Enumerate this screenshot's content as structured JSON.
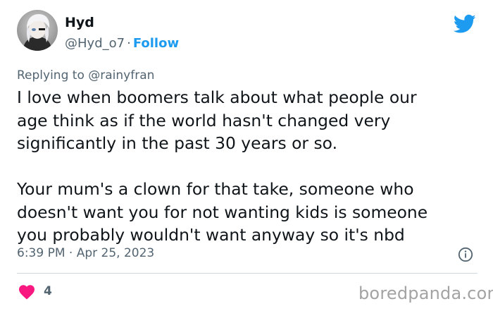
{
  "author": {
    "display_name": "Hyd",
    "handle": "@Hyd_o7",
    "separator": "·",
    "follow_label": "Follow"
  },
  "reply": {
    "prefix": "Replying to",
    "mention": "@rainyfran"
  },
  "tweet": {
    "paragraph1": [
      "I love when boomers talk about what people our",
      "age think as if the world hasn't changed very",
      "significantly in the past 30 years or so."
    ],
    "paragraph2": [
      "Your mum's a clown for that take, someone who",
      "doesn't want you for not wanting kids is someone",
      "you probably wouldn't want anyway so it's nbd"
    ]
  },
  "meta": {
    "time": "6:39 PM",
    "separator": "·",
    "date": "Apr 25, 2023"
  },
  "engagement": {
    "likes": "4"
  },
  "watermark": "boredpanda.com",
  "icons": {
    "avatar": "avatar-image",
    "brand": "twitter-bird-icon",
    "info": "info-icon",
    "like": "heart-icon"
  },
  "colors": {
    "accent": "#1d9bf0",
    "heart": "#f91880",
    "muted": "#536471",
    "text": "#0f1419",
    "divider": "#cfd9de",
    "watermark": "#a3a3a3"
  }
}
